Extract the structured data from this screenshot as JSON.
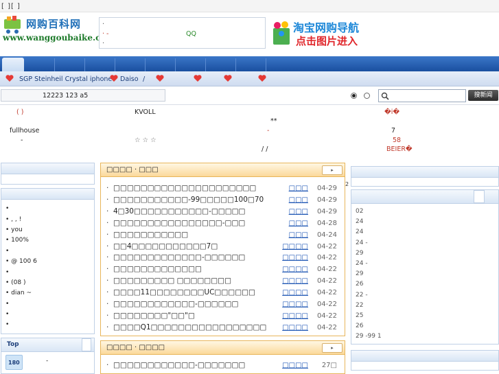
{
  "topbar": {
    "links": "[ ][ ]"
  },
  "header": {
    "logo_title": "网购百科网",
    "logo_url": "www.wanggoubaike.com",
    "notice_line1": "·",
    "notice_line2": "· -",
    "notice_qq": "QQ",
    "notice_line3": "·",
    "banner_line1": "淘宝网购导航",
    "banner_line2": "点击图片进入"
  },
  "subnav": {
    "items": [
      "SGP Steinheil Crystal iphone",
      "Daiso",
      "/"
    ]
  },
  "search": {
    "count_text": "12223 123 a5",
    "button_label": "搜新闻",
    "placeholder": ""
  },
  "info": {
    "r1c1": "(  )",
    "r1c2": "KVOLL",
    "r1c3": "�i�",
    "r2c2": "**",
    "r3c1": "fullhouse",
    "r3c2": "-",
    "r3c3": "7",
    "r4c1": "-",
    "r4c2": "☆  ☆  ☆",
    "r4c3": "58",
    "r5c2": "/ /",
    "r5c3": "BEIER�"
  },
  "left": {
    "lines": [
      "•",
      "• , , !",
      "• you",
      "• 100%",
      "•",
      "• @ 100 6",
      "•",
      "• (08 )",
      "• dian ~",
      "•",
      "•",
      "•"
    ],
    "top_label": "Top",
    "badge": "180",
    "badge_text": "-"
  },
  "news1": {
    "title": "□□□□ · □□□",
    "more": "▸",
    "items": [
      {
        "title": "□□□□□□□□□□□□□□□□□□□□□",
        "src": "□□□",
        "date": "04-29"
      },
      {
        "title": "□□□□□□□□□□□-99□□□□□100□70",
        "src": "□□□",
        "date": "04-29"
      },
      {
        "title": "4□30□□□□□□□□□□□-□□□□□",
        "src": "□□□",
        "date": "04-29"
      },
      {
        "title": "□□□□□□□□□□□□□□□□-□□□",
        "src": "□□□",
        "date": "04-28"
      },
      {
        "title": "□□□□□□□□□□□",
        "src": "□□□",
        "date": "04-24"
      },
      {
        "title": "□□4□□□□□□□□□□□7□",
        "src": "□□□□",
        "date": "04-22"
      },
      {
        "title": "□□□□□□□□□□□□□-□□□□□□",
        "src": "□□□□",
        "date": "04-22"
      },
      {
        "title": "□□□□□□□□□□□□□",
        "src": "□□□□",
        "date": "04-22"
      },
      {
        "title": "□□□□□□□□□ □□□□□□□□",
        "src": "□□□□",
        "date": "04-22"
      },
      {
        "title": "□□□□11□□□□□□□□UC□□□□□□",
        "src": "□□□□",
        "date": "04-22"
      },
      {
        "title": "□□□□□□□□□□□□-□□□□□□",
        "src": "□□□□",
        "date": "04-22"
      },
      {
        "title": "□□□□□□□□\"□□\"□",
        "src": "□□□□",
        "date": "04-22"
      },
      {
        "title": "□□□□Q1□□□□□□□□□□□□□□□□□",
        "src": "□□□□",
        "date": "04-22"
      }
    ]
  },
  "news2": {
    "title": "□□□□ · □□□□",
    "more": "▸",
    "items": [
      {
        "title": "□□□□□□□□□□□□-□□□□□□□",
        "src": "□□□□",
        "date": "27□"
      }
    ]
  },
  "right": {
    "side_number": "2",
    "lines": [
      "02",
      "24",
      "24",
      "24  -",
      "29",
      "24  -",
      "29",
      "26",
      "22  -",
      "22",
      "25",
      "26",
      "29  -99  1"
    ]
  },
  "colors": {
    "nav": "#1a4fa0",
    "accent_orange": "#e8b55a",
    "link_blue": "#1e56b4"
  }
}
